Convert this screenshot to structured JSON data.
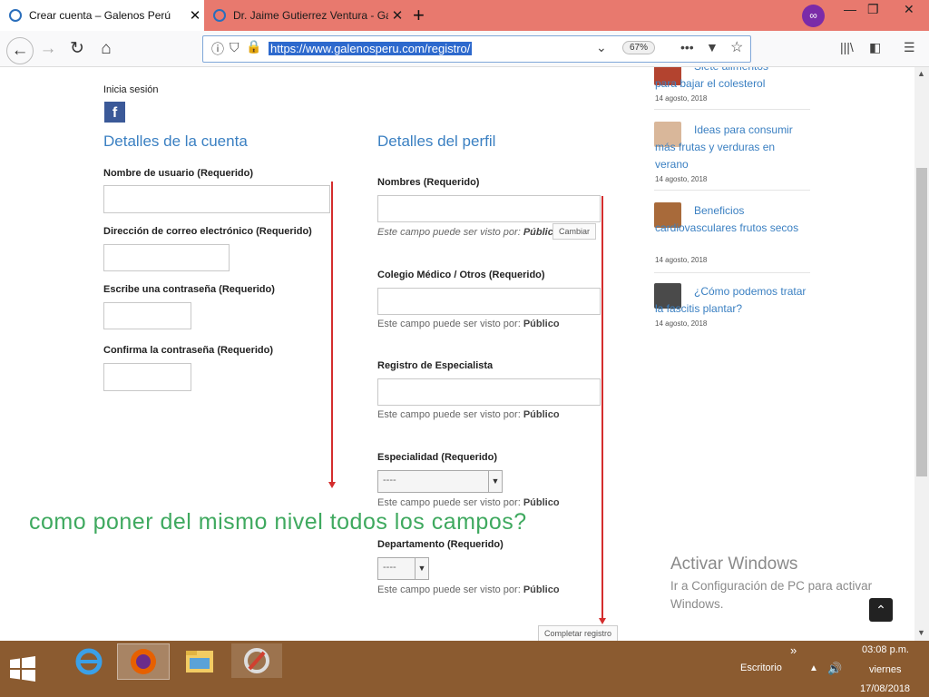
{
  "tabs": [
    {
      "title": "Crear cuenta – Galenos Perú",
      "active": true
    },
    {
      "title": "Dr. Jaime Gutierrez Ventura - Ga",
      "active": false
    }
  ],
  "window_controls": {
    "minimize": "—",
    "restore": "❐",
    "close": "✕"
  },
  "nav": {
    "url": "https://www.galenosperu.com/registro/",
    "zoom": "67%"
  },
  "page": {
    "login_label": "Inicia sesión",
    "account_heading": "Detalles de la cuenta",
    "profile_heading": "Detalles del perfil",
    "account_fields": [
      {
        "label": "Nombre de usuario (Requerido)",
        "value": ""
      },
      {
        "label": "Dirección de correo electrónico (Requerido)",
        "value": ""
      },
      {
        "label": "Escribe una contraseña (Requerido)",
        "value": ""
      },
      {
        "label": "Confirma la contraseña (Requerido)",
        "value": ""
      }
    ],
    "profile_fields": [
      {
        "label": "Nombres (Requerido)",
        "visibility": "Este campo puede ser visto por:",
        "visibility_value": "Público",
        "change_button": "Cambiar"
      },
      {
        "label": "Colegio Médico / Otros (Requerido)",
        "visibility": "Este campo puede ser visto por:",
        "visibility_value": "Público"
      },
      {
        "label": "Registro de Especialista",
        "visibility": "Este campo puede ser visto por:",
        "visibility_value": "Público"
      },
      {
        "label": "Especialidad (Requerido)",
        "selected": "----",
        "visibility": "Este campo puede ser visto por:",
        "visibility_value": "Público"
      },
      {
        "label": "Departamento (Requerido)",
        "selected": "----",
        "visibility": "Este campo puede ser visto por:",
        "visibility_value": "Público"
      }
    ],
    "submit_label": "Completar registro",
    "question": "como poner del mismo nivel todos los campos?",
    "sidebar_posts": [
      {
        "title": "Siete alimentos para bajar el colesterol",
        "date": "14 agosto, 2018"
      },
      {
        "title": "Ideas para consumir más frutas y verduras en verano",
        "date": "14 agosto, 2018"
      },
      {
        "title": "Beneficios cardiovasculares frutos secos",
        "date": "14 agosto, 2018"
      },
      {
        "title": "¿Cómo podemos tratar la fascitis plantar?",
        "date": "14 agosto, 2018"
      }
    ],
    "watermark": {
      "title": "Activar Windows",
      "subtitle": "Ir a Configuración de PC para activar Windows."
    }
  },
  "taskbar": {
    "desktop_label": "Escritorio",
    "chevron": "»",
    "time": "03:08 p.m.",
    "day": "viernes",
    "date": "17/08/2018"
  },
  "colors": {
    "tabbar": "#e8796e",
    "link_blue": "#3b80c2",
    "arrow_red": "#d42d2d",
    "question_green": "#3fa95f",
    "taskbar": "#8b5b30"
  }
}
